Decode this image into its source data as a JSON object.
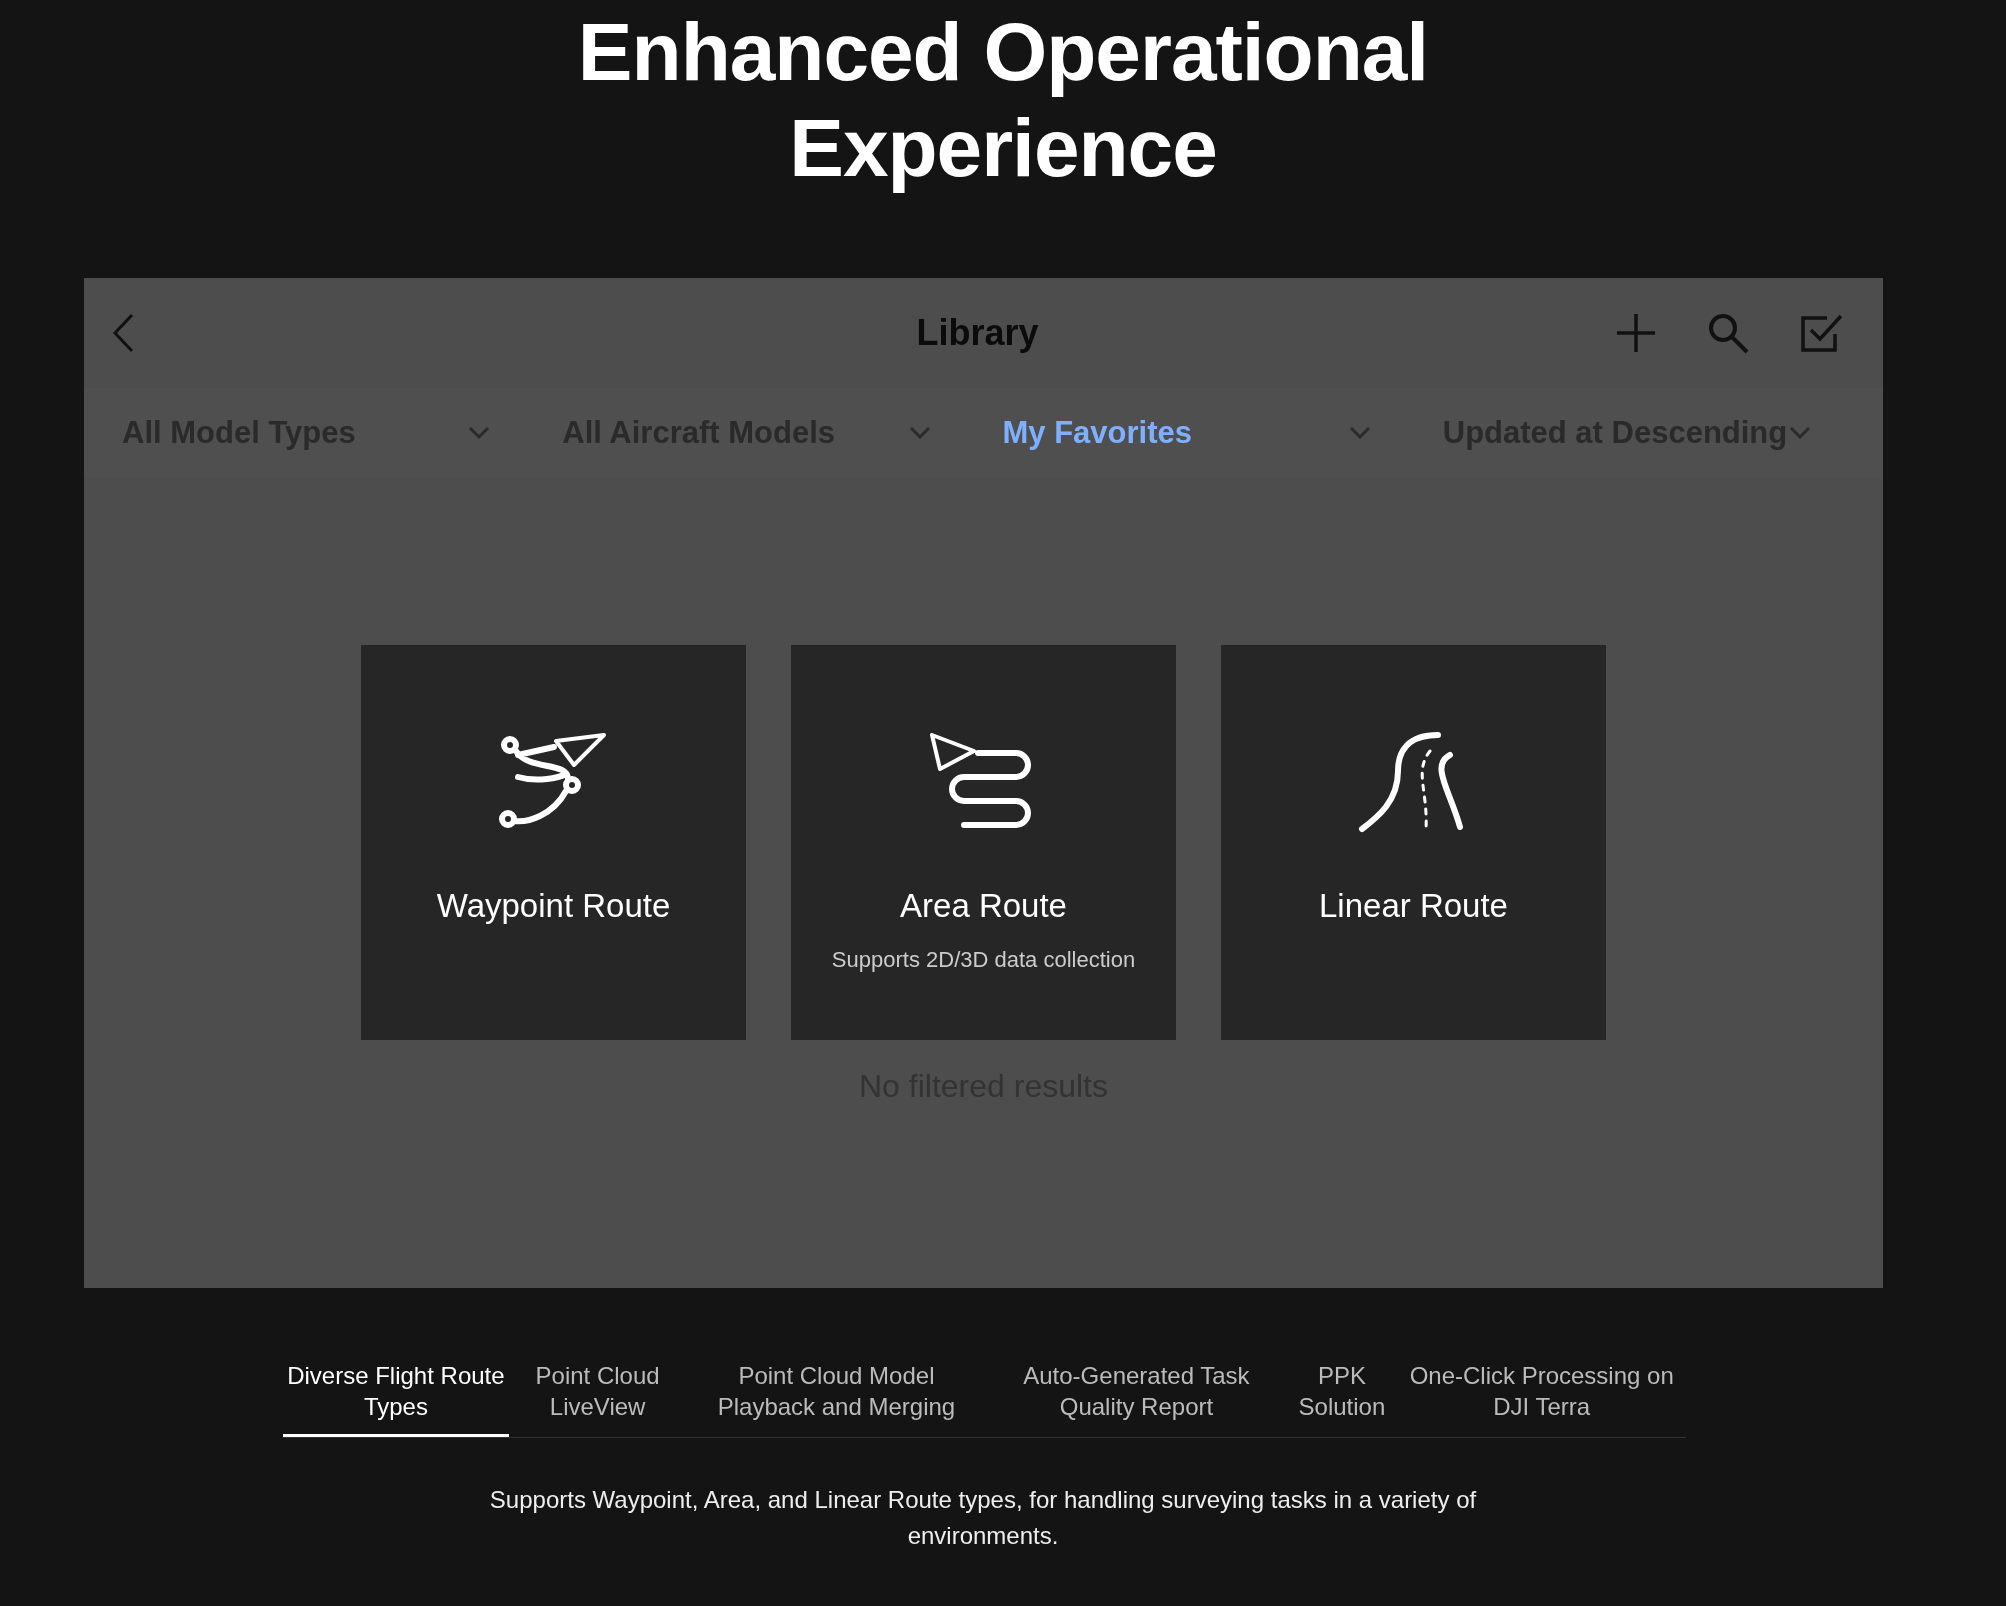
{
  "heading": "Enhanced Operational Experience",
  "app": {
    "title": "Library",
    "filters": [
      {
        "label": "All Model Types",
        "selected": false
      },
      {
        "label": "All Aircraft Models",
        "selected": false
      },
      {
        "label": "My Favorites",
        "selected": true
      },
      {
        "label": "Updated at Descending",
        "selected": false
      }
    ],
    "route_cards": [
      {
        "kind": "waypoint",
        "title": "Waypoint Route"
      },
      {
        "kind": "area",
        "title": "Area Route",
        "subtitle": "Supports 2D/3D data collection"
      },
      {
        "kind": "linear",
        "title": "Linear Route"
      }
    ],
    "empty_message": "No filtered results"
  },
  "tabs": [
    {
      "label": "Diverse Flight Route Types",
      "selected": true
    },
    {
      "label": "Point Cloud LiveView",
      "selected": false
    },
    {
      "label": "Point Cloud Model Playback and Merging",
      "selected": false
    },
    {
      "label": "Auto-Generated Task Quality Report",
      "selected": false
    },
    {
      "label": "PPK Solution",
      "selected": false
    },
    {
      "label": "One-Click Processing on DJI Terra",
      "selected": false
    }
  ],
  "description": "Supports Waypoint, Area, and Linear Route types, for handling surveying tasks in a variety of environments."
}
